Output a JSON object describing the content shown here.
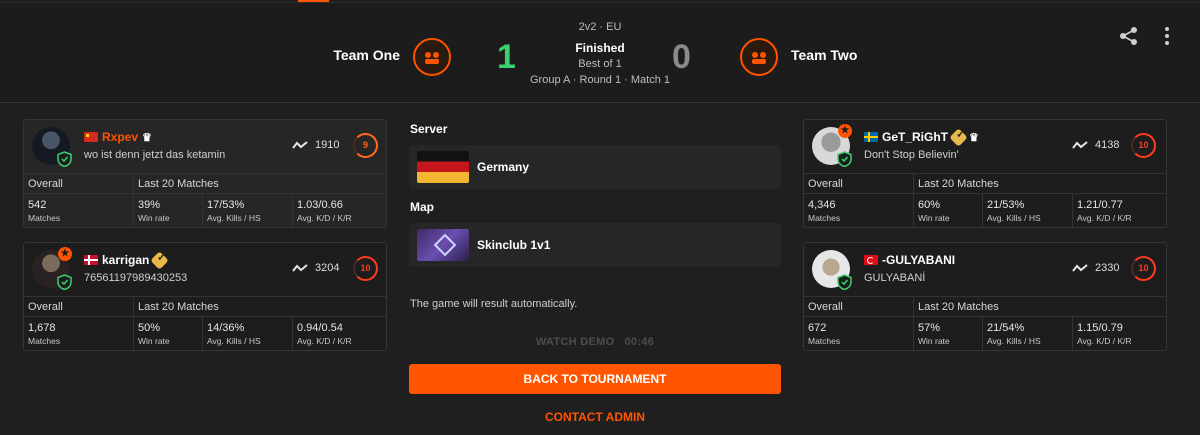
{
  "match": {
    "mode": "2v2 · EU",
    "status": "Finished",
    "best_of": "Best of 1",
    "round": "Group A · Round 1 · Match 1"
  },
  "team_one": {
    "name": "Team One",
    "score": "1"
  },
  "team_two": {
    "name": "Team Two",
    "score": "0"
  },
  "icons": [
    "share-icon",
    "more-vertical-icon",
    "team-logo-icon",
    "shield-icon",
    "elo-trend-icon",
    "crown-icon",
    "verified-icon"
  ],
  "colors": {
    "accent": "#ff5500",
    "win": "#3bd16f",
    "lose": "#8a8a8a",
    "background": "#1f1f1f"
  },
  "players_left": [
    {
      "flag": "CN",
      "nick": "Rxpev",
      "subtitle": "wo ist denn jetzt das ketamin",
      "elo": "1910",
      "level": "9",
      "headers": {
        "overall": "Overall",
        "last20": "Last 20 Matches"
      },
      "stats": [
        {
          "value": "542",
          "label": "Matches"
        },
        {
          "value": "39%",
          "label": "Win rate"
        },
        {
          "value": "17/53%",
          "label": "Avg. Kills / HS"
        },
        {
          "value": "1.03/0.66",
          "label": "Avg. K/D / K/R"
        }
      ]
    },
    {
      "flag": "DK",
      "nick": "karrigan",
      "subtitle": "76561197989430253",
      "elo": "3204",
      "level": "10",
      "headers": {
        "overall": "Overall",
        "last20": "Last 20 Matches"
      },
      "stats": [
        {
          "value": "1,678",
          "label": "Matches"
        },
        {
          "value": "50%",
          "label": "Win rate"
        },
        {
          "value": "14/36%",
          "label": "Avg. Kills / HS"
        },
        {
          "value": "0.94/0.54",
          "label": "Avg. K/D / K/R"
        }
      ]
    }
  ],
  "players_right": [
    {
      "flag": "SE",
      "nick": "GeT_RiGhT",
      "subtitle": "Don't Stop Believin'",
      "elo": "4138",
      "level": "10",
      "headers": {
        "overall": "Overall",
        "last20": "Last 20 Matches"
      },
      "stats": [
        {
          "value": "4,346",
          "label": "Matches"
        },
        {
          "value": "60%",
          "label": "Win rate"
        },
        {
          "value": "21/53%",
          "label": "Avg. Kills / HS"
        },
        {
          "value": "1.21/0.77",
          "label": "Avg. K/D / K/R"
        }
      ]
    },
    {
      "flag": "TR",
      "nick": "-GULYABANI",
      "subtitle": "GULYABANİ",
      "elo": "2330",
      "level": "10",
      "headers": {
        "overall": "Overall",
        "last20": "Last 20 Matches"
      },
      "stats": [
        {
          "value": "672",
          "label": "Matches"
        },
        {
          "value": "57%",
          "label": "Win rate"
        },
        {
          "value": "21/54%",
          "label": "Avg. Kills / HS"
        },
        {
          "value": "1.15/0.79",
          "label": "Avg. K/D / K/R"
        }
      ]
    }
  ],
  "server": {
    "title": "Server",
    "name": "Germany"
  },
  "map": {
    "title": "Map",
    "name": "Skinclub 1v1"
  },
  "auto_result_text": "The game will result automatically.",
  "watch_demo": "WATCH DEMO   00:46",
  "back_button": "BACK TO TOURNAMENT",
  "contact_admin": "CONTACT ADMIN"
}
